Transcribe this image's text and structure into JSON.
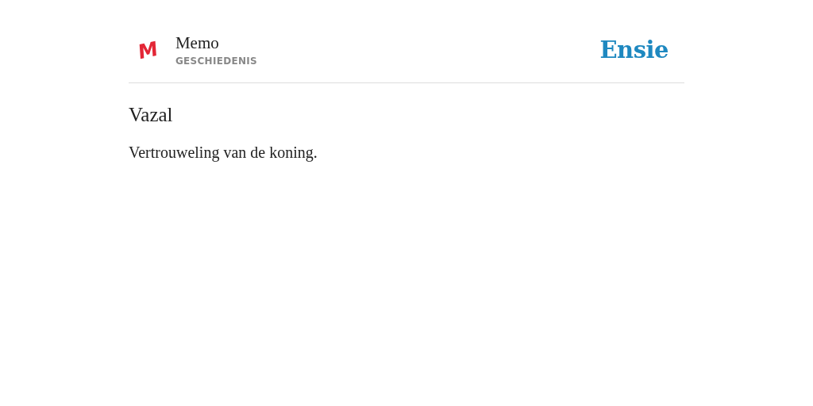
{
  "header": {
    "logo_mark": "M",
    "title": "Memo",
    "subtitle": "GESCHIEDENIS",
    "brand": "Ensie"
  },
  "entry": {
    "term": "Vazal",
    "definition": "Vertrouweling van de koning."
  }
}
